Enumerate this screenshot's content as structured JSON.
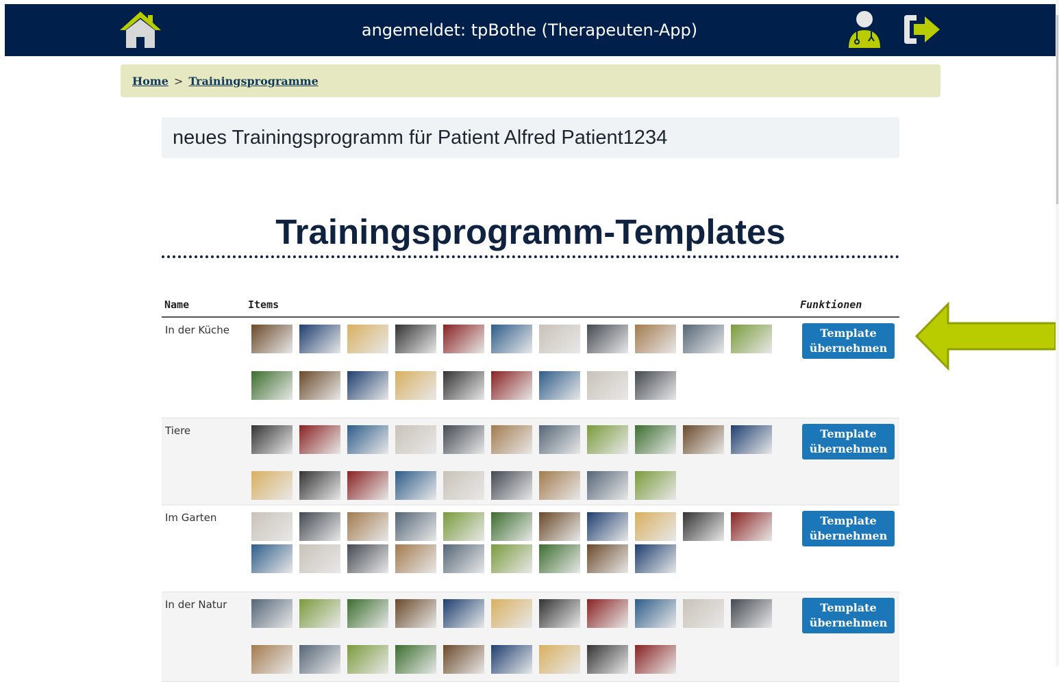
{
  "header": {
    "title": "angemeldet: tpBothe (Therapeuten-App)",
    "home_icon": "home-icon",
    "user_icon": "doctor-user-icon",
    "logout_icon": "logout-icon",
    "bar_color": "#001f4a",
    "accent_color": "#b8cc00"
  },
  "breadcrumb": {
    "home": "Home",
    "separator": ">",
    "current": "Trainingsprogramme"
  },
  "patient_banner": "neues Trainingsprogramm für Patient Alfred Patient1234",
  "page_heading": "Trainingsprogramm-Templates",
  "table": {
    "columns": {
      "name": "Name",
      "items": "Items",
      "functions": "Funktionen"
    },
    "rows": [
      {
        "name": "In der Küche",
        "button": "Template übernehmen",
        "item_count": 20
      },
      {
        "name": "Tiere",
        "button": "Template übernehmen",
        "item_count": 20
      },
      {
        "name": "Im Garten",
        "button": "Template übernehmen",
        "item_count": 20
      },
      {
        "name": "In der Natur",
        "button": "Template übernehmen",
        "item_count": 20
      }
    ]
  },
  "annotation": {
    "arrow_icon": "left-arrow-annotation-icon",
    "arrow_color": "#b8cc00"
  }
}
